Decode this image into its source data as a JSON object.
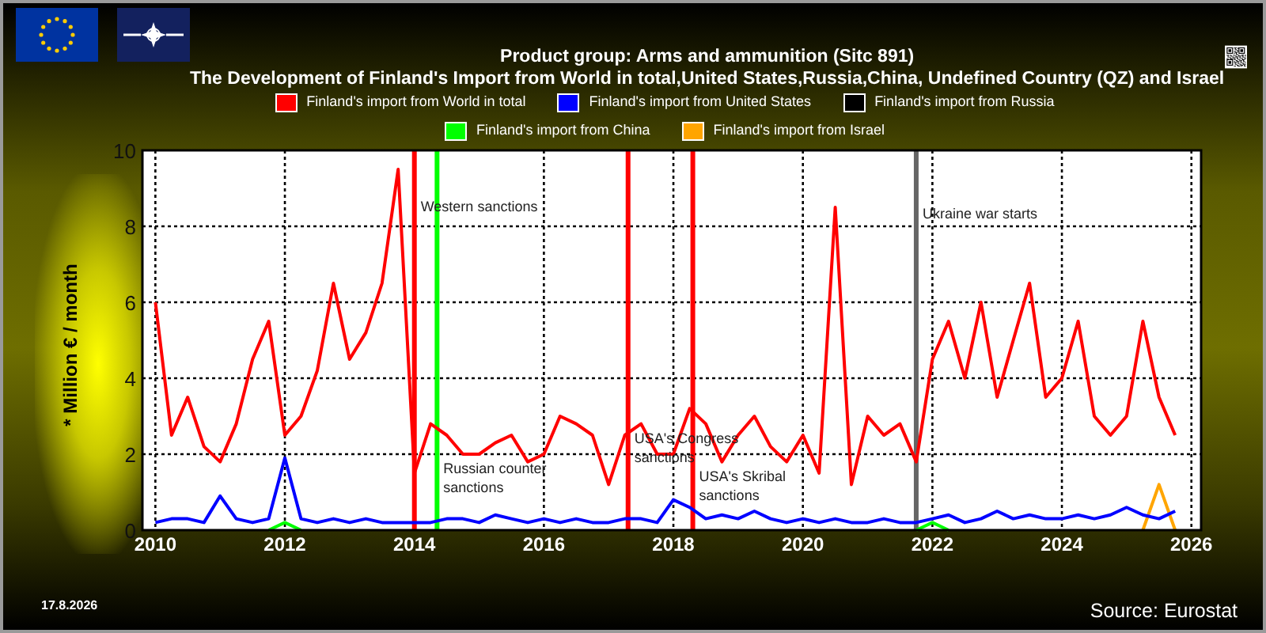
{
  "header": {
    "title": "Product group: Arms and ammunition (Sitc 891)",
    "subtitle": "The Development of Finland's Import from World in total,United States,Russia,China, Undefined Country (QZ) and Israel"
  },
  "chart_data": {
    "type": "line",
    "grid": true,
    "ylabel": "* Million € / month",
    "xlim": [
      2009.8,
      2026.15
    ],
    "ylim": [
      0,
      10
    ],
    "yticks": [
      0,
      2,
      4,
      6,
      8,
      10
    ],
    "xticks": [
      2010,
      2012,
      2014,
      2016,
      2018,
      2020,
      2022,
      2024,
      2026
    ],
    "x": [
      2010,
      2010.25,
      2010.5,
      2010.75,
      2011,
      2011.25,
      2011.5,
      2011.75,
      2012,
      2012.25,
      2012.5,
      2012.75,
      2013,
      2013.25,
      2013.5,
      2013.75,
      2014,
      2014.25,
      2014.5,
      2014.75,
      2015,
      2015.25,
      2015.5,
      2015.75,
      2016,
      2016.25,
      2016.5,
      2016.75,
      2017,
      2017.25,
      2017.5,
      2017.75,
      2018,
      2018.25,
      2018.5,
      2018.75,
      2019,
      2019.25,
      2019.5,
      2019.75,
      2020,
      2020.25,
      2020.5,
      2020.75,
      2021,
      2021.25,
      2021.5,
      2021.75,
      2022,
      2022.25,
      2022.5,
      2022.75,
      2023,
      2023.25,
      2023.5,
      2023.75,
      2024,
      2024.25,
      2024.5,
      2024.75,
      2025,
      2025.25,
      2025.5,
      2025.75
    ],
    "series": [
      {
        "name": "Finland's import from World in total",
        "color": "#ff0000",
        "values": [
          6.0,
          2.5,
          3.5,
          2.2,
          1.8,
          2.8,
          4.5,
          5.5,
          2.5,
          3.0,
          4.2,
          6.5,
          4.5,
          5.2,
          6.5,
          9.5,
          1.5,
          2.8,
          2.5,
          2.0,
          2.0,
          2.3,
          2.5,
          1.8,
          2.0,
          3.0,
          2.8,
          2.5,
          1.2,
          2.5,
          2.8,
          2.0,
          2.0,
          3.2,
          2.8,
          1.8,
          2.5,
          3.0,
          2.2,
          1.8,
          2.5,
          1.5,
          8.5,
          1.2,
          3.0,
          2.5,
          2.8,
          1.8,
          4.5,
          5.5,
          4.0,
          6.0,
          3.5,
          5.0,
          6.5,
          3.5,
          4.0,
          5.5,
          3.0,
          2.5,
          3.0,
          5.5,
          3.5,
          2.5
        ]
      },
      {
        "name": "Finland's import from United States",
        "color": "#0000ff",
        "values": [
          0.2,
          0.3,
          0.3,
          0.2,
          0.9,
          0.3,
          0.2,
          0.3,
          1.9,
          0.3,
          0.2,
          0.3,
          0.2,
          0.3,
          0.2,
          0.2,
          0.2,
          0.2,
          0.3,
          0.3,
          0.2,
          0.4,
          0.3,
          0.2,
          0.3,
          0.2,
          0.3,
          0.2,
          0.2,
          0.3,
          0.3,
          0.2,
          0.8,
          0.6,
          0.3,
          0.4,
          0.3,
          0.5,
          0.3,
          0.2,
          0.3,
          0.2,
          0.3,
          0.2,
          0.2,
          0.3,
          0.2,
          0.2,
          0.3,
          0.4,
          0.2,
          0.3,
          0.5,
          0.3,
          0.4,
          0.3,
          0.3,
          0.4,
          0.3,
          0.4,
          0.6,
          0.4,
          0.3,
          0.5
        ]
      },
      {
        "name": "Finland's import from Russia",
        "color": "#000000",
        "values": [
          null,
          null,
          null,
          null,
          null,
          null,
          null,
          null,
          null,
          null,
          null,
          null,
          null,
          null,
          null,
          null,
          null,
          null,
          null,
          null,
          null,
          null,
          null,
          null,
          null,
          null,
          null,
          null,
          null,
          null,
          null,
          null,
          null,
          null,
          null,
          null,
          null,
          null,
          null,
          null,
          null,
          null,
          null,
          null,
          null,
          null,
          null,
          null,
          null,
          null,
          null,
          null,
          null,
          null,
          null,
          null,
          null,
          null,
          null,
          null,
          null,
          null,
          null,
          null
        ]
      },
      {
        "name": "Finland's import from China",
        "color": "#00ff00",
        "values": [
          null,
          null,
          null,
          null,
          null,
          null,
          null,
          0.0,
          0.2,
          0.0,
          null,
          null,
          null,
          null,
          null,
          null,
          null,
          null,
          null,
          null,
          null,
          null,
          null,
          null,
          null,
          null,
          null,
          null,
          null,
          null,
          null,
          null,
          null,
          null,
          null,
          null,
          null,
          null,
          null,
          null,
          null,
          null,
          null,
          null,
          null,
          null,
          null,
          0.0,
          0.2,
          0.0,
          null,
          null,
          null,
          null,
          null,
          null,
          null,
          null,
          null,
          null,
          null,
          null,
          null,
          null
        ]
      },
      {
        "name": "Finland's import from Israel",
        "color": "#ffa500",
        "values": [
          null,
          null,
          null,
          null,
          null,
          null,
          null,
          null,
          null,
          null,
          null,
          null,
          null,
          null,
          null,
          null,
          null,
          null,
          null,
          null,
          null,
          null,
          null,
          null,
          null,
          null,
          null,
          null,
          null,
          null,
          null,
          null,
          null,
          null,
          null,
          null,
          null,
          null,
          null,
          null,
          null,
          null,
          null,
          null,
          null,
          null,
          null,
          null,
          null,
          null,
          null,
          null,
          null,
          null,
          null,
          null,
          null,
          null,
          null,
          null,
          null,
          0.0,
          1.2,
          0.0
        ]
      }
    ],
    "ref_lines": [
      {
        "axis": "x",
        "value": 2014.0,
        "color": "#ff0000"
      },
      {
        "axis": "x",
        "value": 2014.35,
        "color": "#00ff00"
      },
      {
        "axis": "x",
        "value": 2017.3,
        "color": "#ff0000"
      },
      {
        "axis": "x",
        "value": 2018.3,
        "color": "#ff0000"
      },
      {
        "axis": "x",
        "value": 2021.75,
        "color": "#666666"
      }
    ],
    "annotations": [
      {
        "x": 2014.0,
        "y": 8.4,
        "text": "Western sanctions"
      },
      {
        "x": 2014.35,
        "y": 1.5,
        "text": "Russian counter\nsanctions"
      },
      {
        "x": 2017.3,
        "y": 2.3,
        "text": "USA's Congress\nsanctions"
      },
      {
        "x": 2018.3,
        "y": 1.3,
        "text": "USA's Skribal\nsanctions"
      },
      {
        "x": 2021.75,
        "y": 8.2,
        "text": "Ukraine war starts"
      }
    ]
  },
  "footer": {
    "date": "17.8.2026",
    "source": "Source: Eurostat"
  }
}
